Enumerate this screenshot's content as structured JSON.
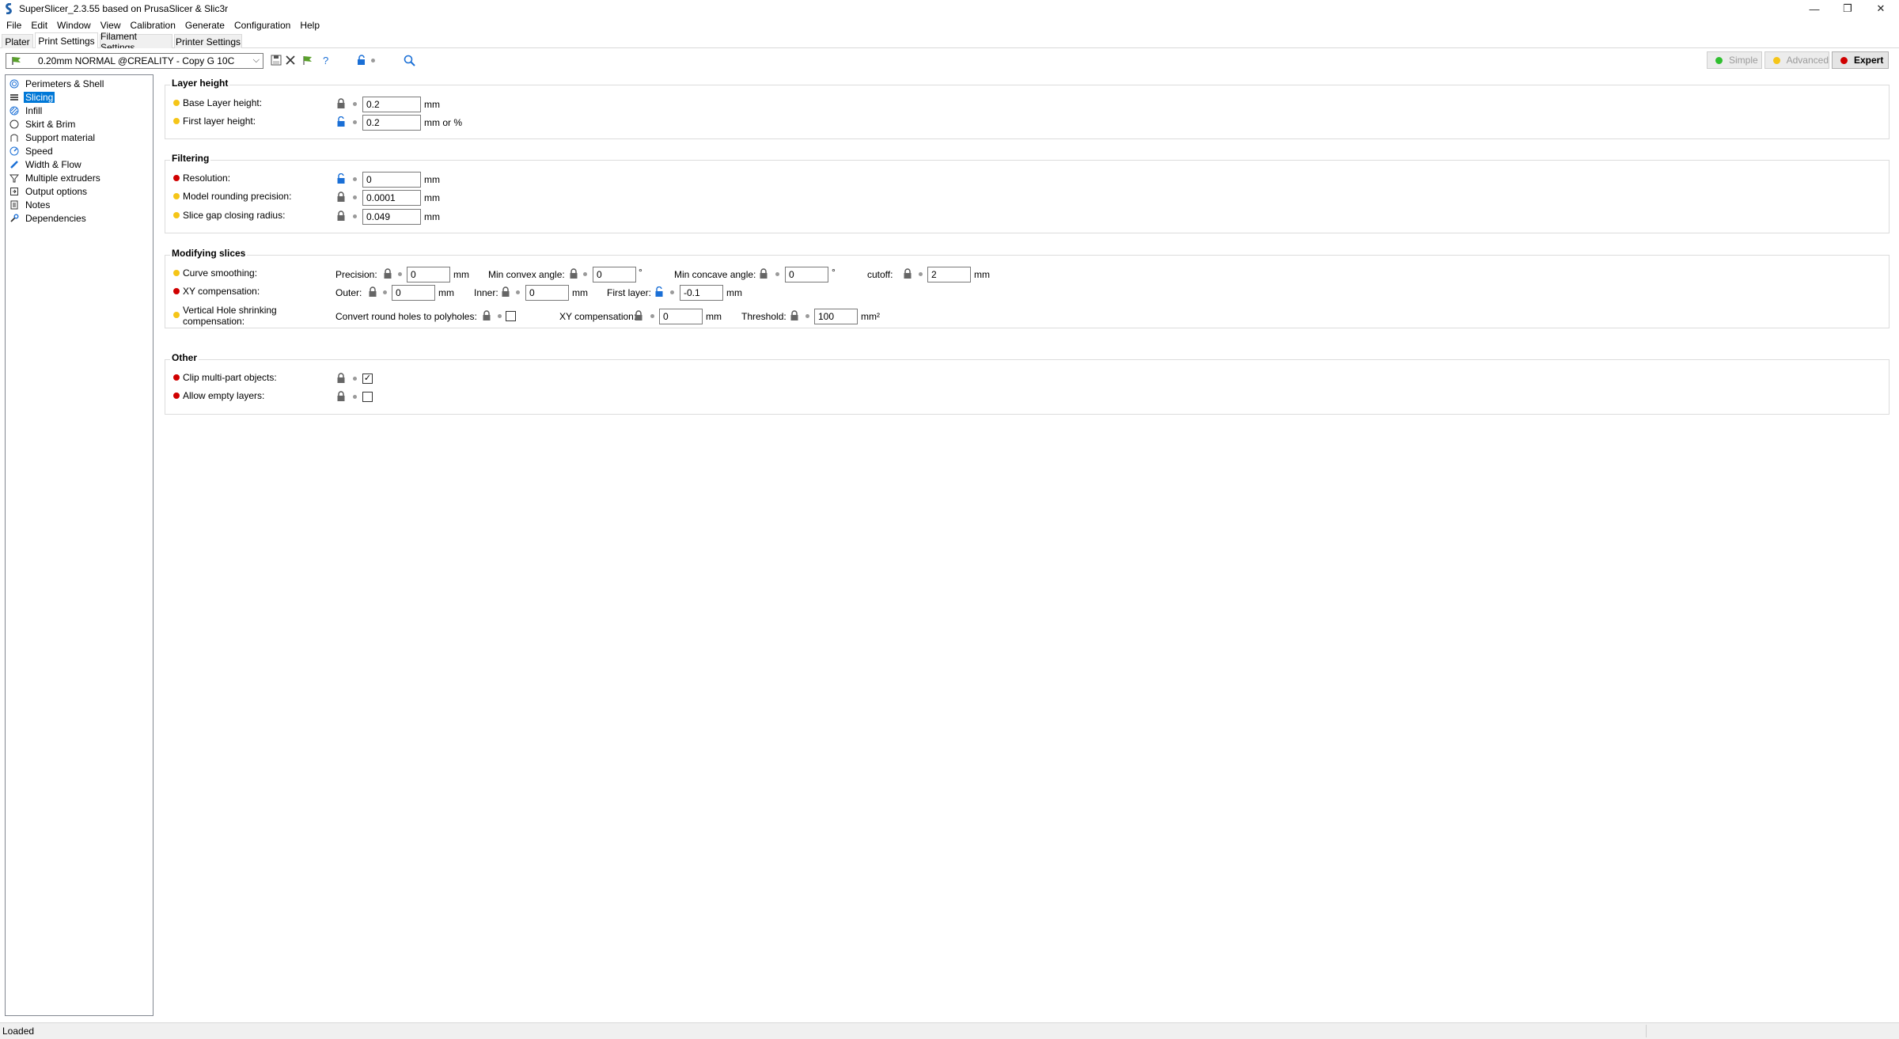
{
  "window": {
    "title": "SuperSlicer_2.3.55 based on PrusaSlicer & Slic3r",
    "controls": [
      "—",
      "❐",
      "✕"
    ]
  },
  "menu": [
    "File",
    "Edit",
    "Window",
    "View",
    "Calibration",
    "Generate",
    "Configuration",
    "Help"
  ],
  "tabs": [
    "Plater",
    "Print Settings",
    "Filament Settings",
    "Printer Settings"
  ],
  "toolbar": {
    "preset": "0.20mm NORMAL @CREALITY - Copy G 10C",
    "modes": [
      "Simple",
      "Advanced",
      "Expert"
    ],
    "mode_colors": [
      "#2fbf2f",
      "#f5c518",
      "#d00000"
    ]
  },
  "tree": [
    {
      "label": "Perimeters & Shell",
      "icon": "shell-icon"
    },
    {
      "label": "Slicing",
      "icon": "layers-icon"
    },
    {
      "label": "Infill",
      "icon": "infill-icon"
    },
    {
      "label": "Skirt & Brim",
      "icon": "brim-icon"
    },
    {
      "label": "Support material",
      "icon": "support-icon"
    },
    {
      "label": "Speed",
      "icon": "speed-icon"
    },
    {
      "label": "Width & Flow",
      "icon": "width-icon"
    },
    {
      "label": "Multiple extruders",
      "icon": "funnel-icon"
    },
    {
      "label": "Output options",
      "icon": "output-icon"
    },
    {
      "label": "Notes",
      "icon": "notes-icon"
    },
    {
      "label": "Dependencies",
      "icon": "wrench-icon"
    }
  ],
  "groups": {
    "layer_height": {
      "title": "Layer height",
      "base": {
        "label": "Base Layer height:",
        "value": "0.2",
        "unit": "mm"
      },
      "first": {
        "label": "First layer height:",
        "value": "0.2",
        "unit": "mm or %"
      }
    },
    "filtering": {
      "title": "Filtering",
      "resolution": {
        "label": "Resolution:",
        "value": "0",
        "unit": "mm"
      },
      "rounding": {
        "label": "Model rounding precision:",
        "value": "0.0001",
        "unit": "mm"
      },
      "gap": {
        "label": "Slice gap closing radius:",
        "value": "0.049",
        "unit": "mm"
      }
    },
    "modifying": {
      "title": "Modifying slices",
      "curve": {
        "label": "Curve smoothing:",
        "precision_label": "Precision:",
        "precision_value": "0",
        "precision_unit": "mm",
        "convex_label": "Min convex angle:",
        "convex_value": "0",
        "convex_unit": "°",
        "concave_label": "Min concave angle:",
        "concave_value": "0",
        "concave_unit": "°",
        "cutoff_label": "cutoff:",
        "cutoff_value": "2",
        "cutoff_unit": "mm"
      },
      "xy": {
        "label": "XY compensation:",
        "outer_label": "Outer:",
        "outer_value": "0",
        "outer_unit": "mm",
        "inner_label": "Inner:",
        "inner_value": "0",
        "inner_unit": "mm",
        "first_label": "First layer:",
        "first_value": "-0.1",
        "first_unit": "mm"
      },
      "hole": {
        "label_line1": "Vertical Hole shrinking",
        "label_line2": "compensation:",
        "convert_label": "Convert round holes to polyholes:",
        "xy_label": "XY compensation:",
        "xy_value": "0",
        "xy_unit": "mm",
        "threshold_label": "Threshold:",
        "threshold_value": "100",
        "threshold_unit": "mm²"
      }
    },
    "other": {
      "title": "Other",
      "clip": {
        "label": "Clip multi-part objects:",
        "checked": "✓"
      },
      "empty": {
        "label": "Allow empty layers:",
        "checked": ""
      }
    }
  },
  "status": "Loaded"
}
